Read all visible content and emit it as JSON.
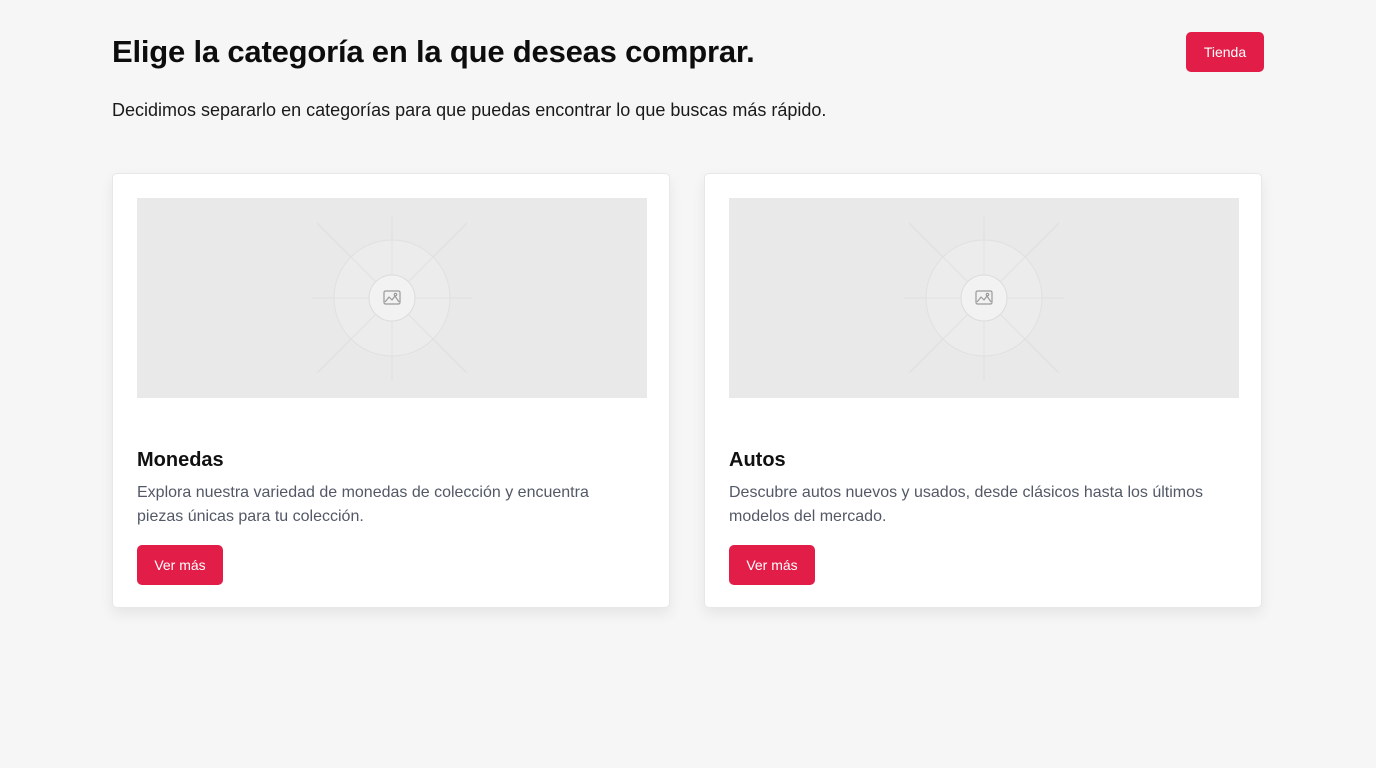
{
  "header": {
    "title": "Elige la categoría en la que deseas comprar.",
    "subtitle": "Decidimos separarlo en categorías para que puedas encontrar lo que buscas más rápido.",
    "store_button": "Tienda"
  },
  "categories": [
    {
      "name": "Monedas",
      "description": "Explora nuestra variedad de monedas de colección y encuentra piezas únicas para tu colección.",
      "button": "Ver más",
      "image_icon": "image-placeholder-icon"
    },
    {
      "name": "Autos",
      "description": "Descubre autos nuevos y usados, desde clásicos hasta los últimos modelos del mercado.",
      "button": "Ver más",
      "image_icon": "image-placeholder-icon"
    }
  ],
  "colors": {
    "accent": "#e11d48",
    "background": "#f6f6f6",
    "card": "#ffffff",
    "placeholder": "#e9e9e9"
  }
}
